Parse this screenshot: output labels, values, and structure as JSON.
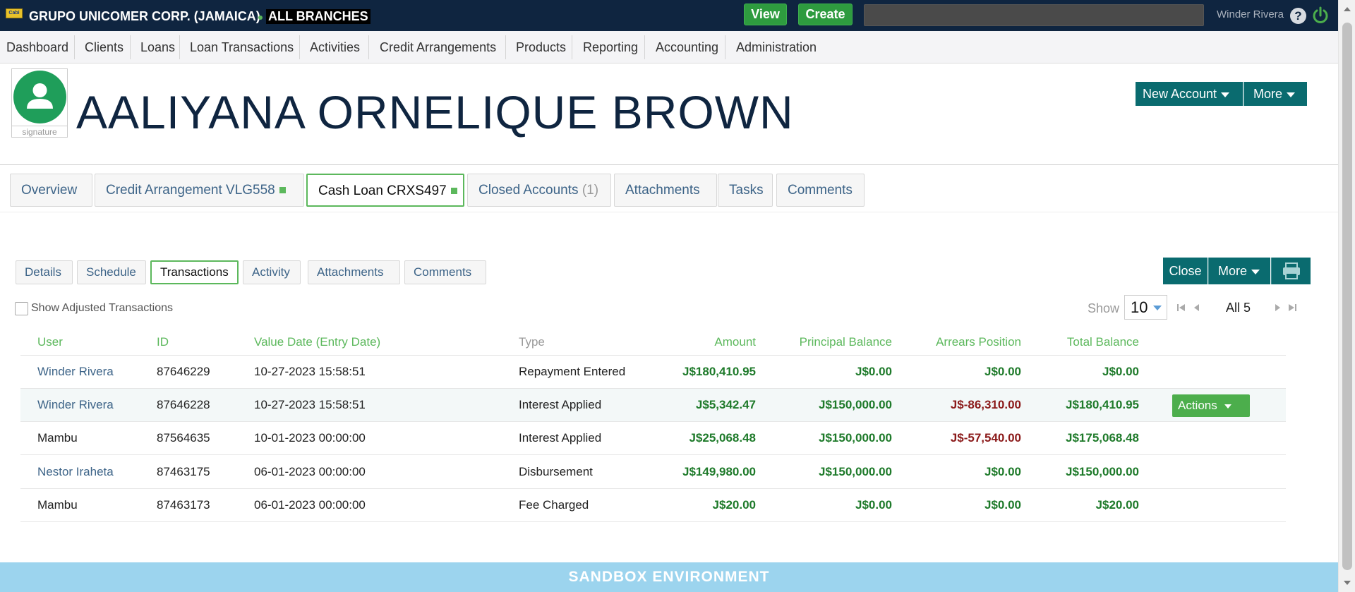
{
  "header": {
    "logo_text": "Cabi",
    "org_name": "GRUPO UNICOMER CORP. (JAMAICA)",
    "branch": "ALL BRANCHES",
    "view_label": "View",
    "create_label": "Create",
    "search_value": "",
    "user_name": "Winder Rivera",
    "help_glyph": "?"
  },
  "nav": {
    "items": [
      "Dashboard",
      "Clients",
      "Loans",
      "Loan Transactions",
      "Activities",
      "Credit Arrangements",
      "Products",
      "Reporting",
      "Accounting",
      "Administration"
    ]
  },
  "client": {
    "signature_label": "signature",
    "name": "AALIYANA ORNELIQUE BROWN",
    "new_account_label": "New Account",
    "more_label": "More"
  },
  "tabs": {
    "overview": "Overview",
    "credit_arrangement": "Credit Arrangement VLG558",
    "cash_loan": "Cash Loan CRXS497",
    "closed_accounts": "Closed Accounts",
    "closed_count": "(1)",
    "attachments": "Attachments",
    "tasks": "Tasks",
    "comments": "Comments"
  },
  "subtabs": {
    "details": "Details",
    "schedule": "Schedule",
    "transactions": "Transactions",
    "activity": "Activity",
    "attachments": "Attachments",
    "comments": "Comments",
    "close_label": "Close",
    "more_label": "More"
  },
  "filters": {
    "show_adjusted": "Show Adjusted Transactions",
    "show_label": "Show",
    "show_value": "10",
    "all_label": "All 5"
  },
  "table": {
    "headers": {
      "user": "User",
      "id": "ID",
      "value_date": "Value Date (Entry Date)",
      "type": "Type",
      "amount": "Amount",
      "principal": "Principal Balance",
      "arrears": "Arrears Position",
      "total": "Total Balance"
    },
    "rows": [
      {
        "user": "Winder Rivera",
        "id": "87646229",
        "date": "10-27-2023 15:58:51",
        "type": "Repayment Entered",
        "amount": "J$180,410.95",
        "principal": "J$0.00",
        "arrears": "J$0.00",
        "total": "J$0.00"
      },
      {
        "user": "Winder Rivera",
        "id": "87646228",
        "date": "10-27-2023 15:58:51",
        "type": "Interest Applied",
        "amount": "J$5,342.47",
        "principal": "J$150,000.00",
        "arrears": "J$-86,310.00",
        "total": "J$180,410.95"
      },
      {
        "user": "Mambu",
        "id": "87564635",
        "date": "10-01-2023 00:00:00",
        "type": "Interest Applied",
        "amount": "J$25,068.48",
        "principal": "J$150,000.00",
        "arrears": "J$-57,540.00",
        "total": "J$175,068.48"
      },
      {
        "user": "Nestor Iraheta",
        "id": "87463175",
        "date": "06-01-2023 00:00:00",
        "type": "Disbursement",
        "amount": "J$149,980.00",
        "principal": "J$150,000.00",
        "arrears": "J$0.00",
        "total": "J$150,000.00"
      },
      {
        "user": "Mambu",
        "id": "87463173",
        "date": "06-01-2023 00:00:00",
        "type": "Fee Charged",
        "amount": "J$20.00",
        "principal": "J$0.00",
        "arrears": "J$0.00",
        "total": "J$20.00"
      }
    ],
    "actions_label": "Actions"
  },
  "footer": {
    "sandbox": "SANDBOX ENVIRONMENT"
  },
  "colors": {
    "topbar": "#0f2540",
    "accent_green": "#5cb85c",
    "teal": "#0a6b6f",
    "money_green": "#1e7a2a",
    "negative_red": "#8b1a1a",
    "sandbox": "#9cd4ee"
  },
  "icons": [
    "logo-icon",
    "help-icon",
    "power-icon",
    "user-avatar-icon",
    "caret-down-icon",
    "print-icon",
    "first-page-icon",
    "prev-page-icon",
    "next-page-icon",
    "last-page-icon"
  ]
}
